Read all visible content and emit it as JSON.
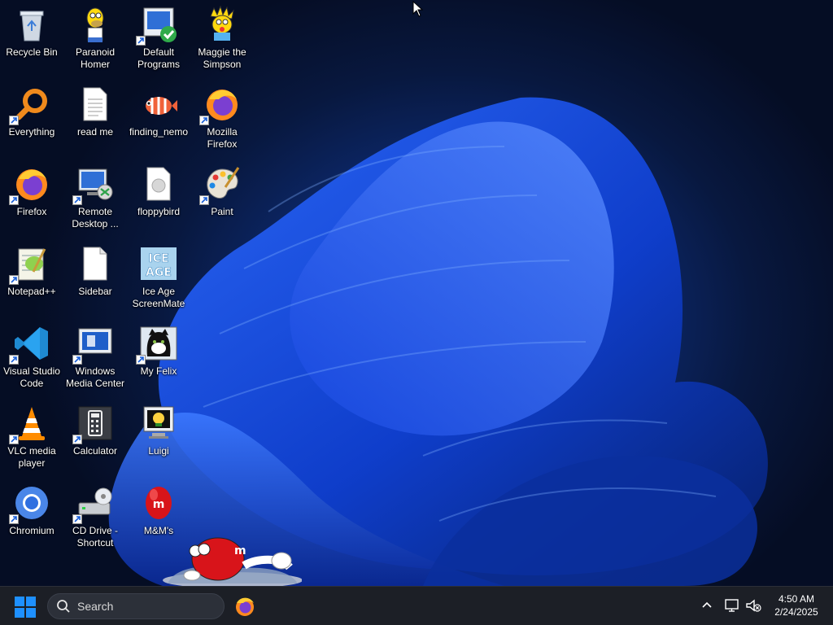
{
  "desktop": {
    "icons": [
      {
        "label": "Recycle Bin",
        "icon": "recycle-bin-icon"
      },
      {
        "label": "Paranoid\nHomer",
        "icon": "homer-icon"
      },
      {
        "label": "Default\nPrograms",
        "icon": "default-programs-icon"
      },
      {
        "label": "Maggie the\nSimpson",
        "icon": "maggie-icon"
      },
      {
        "label": "Everything",
        "icon": "everything-search-icon"
      },
      {
        "label": "read me",
        "icon": "text-file-icon"
      },
      {
        "label": "finding_nemo",
        "icon": "nemo-icon"
      },
      {
        "label": "Mozilla\nFirefox",
        "icon": "firefox-icon"
      },
      {
        "label": "Firefox",
        "icon": "firefox-icon"
      },
      {
        "label": "Remote\nDesktop ...",
        "icon": "remote-desktop-icon"
      },
      {
        "label": "floppybird",
        "icon": "file-icon"
      },
      {
        "label": "Paint",
        "icon": "paint-palette-icon"
      },
      {
        "label": "Notepad++",
        "icon": "notepad-plus-plus-icon"
      },
      {
        "label": "Sidebar",
        "icon": "blank-file-icon"
      },
      {
        "label": "Ice Age\nScreenMate",
        "icon": "ice-age-icon"
      },
      {
        "label": "Visual Studio\nCode",
        "icon": "vscode-icon"
      },
      {
        "label": "Windows\nMedia Center",
        "icon": "media-center-icon"
      },
      {
        "label": "My Felix",
        "icon": "felix-cat-icon"
      },
      {
        "label": "VLC media\nplayer",
        "icon": "vlc-cone-icon"
      },
      {
        "label": "Calculator",
        "icon": "calculator-icon"
      },
      {
        "label": "Luigi",
        "icon": "luigi-monitor-icon"
      },
      {
        "label": "Chromium",
        "icon": "chromium-icon"
      },
      {
        "label": "CD Drive -\nShortcut",
        "icon": "cd-drive-icon"
      },
      {
        "label": "M&M's",
        "icon": "m-and-m-icon"
      }
    ]
  },
  "taskbar": {
    "search_placeholder": "Search",
    "pinned": [
      {
        "name": "Firefox",
        "icon": "firefox-icon"
      }
    ],
    "clock": {
      "time": "4:50 AM",
      "date": "2/24/2025"
    }
  },
  "colors": {
    "taskbar_bg": "#1c1f26",
    "wallpaper_blue": "#1a4fd8",
    "start_blue": "#1e90ff"
  }
}
